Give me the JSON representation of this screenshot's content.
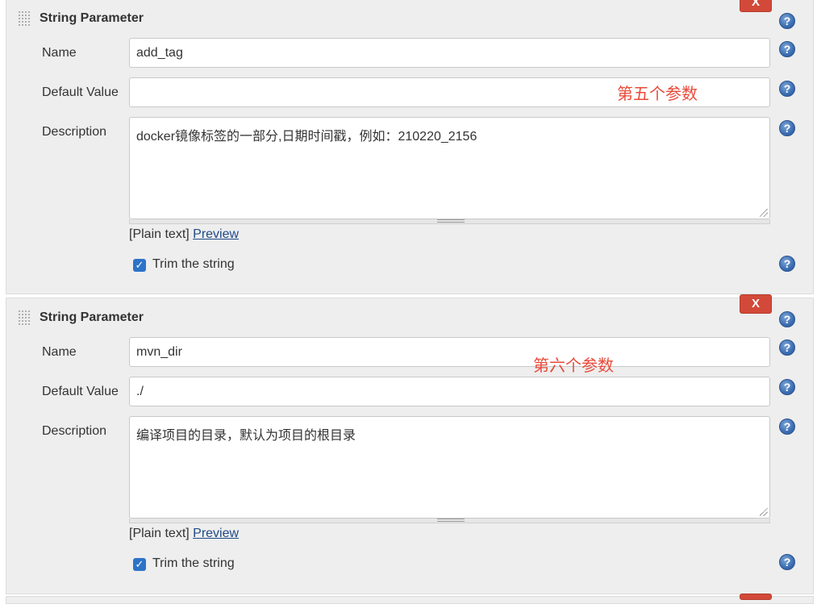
{
  "parameters": [
    {
      "title": "String Parameter",
      "delete_label": "X",
      "name_label": "Name",
      "name_value": "add_tag",
      "default_label": "Default Value",
      "default_value": "",
      "description_label": "Description",
      "description_value": "docker镜像标签的一部分,日期时间戳，例如：210220_2156",
      "markup_plain": "[Plain text]",
      "markup_preview": "Preview",
      "trim_checked": true,
      "trim_label": "Trim the string",
      "annotation": "第五个参数"
    },
    {
      "title": "String Parameter",
      "delete_label": "X",
      "name_label": "Name",
      "name_value": "mvn_dir",
      "default_label": "Default Value",
      "default_value": "./",
      "description_label": "Description",
      "description_value": "编译项目的目录，默认为项目的根目录",
      "markup_plain": "[Plain text]",
      "markup_preview": "Preview",
      "trim_checked": true,
      "trim_label": "Trim the string",
      "annotation": "第六个参数"
    }
  ],
  "help_icon_glyph": "?",
  "check_glyph": "✓",
  "colors": {
    "delete_button": "#d24939",
    "help_icon": "#3b6db3",
    "checkbox": "#2d73c8",
    "annotation": "#e84a3a",
    "link": "#204a87"
  }
}
